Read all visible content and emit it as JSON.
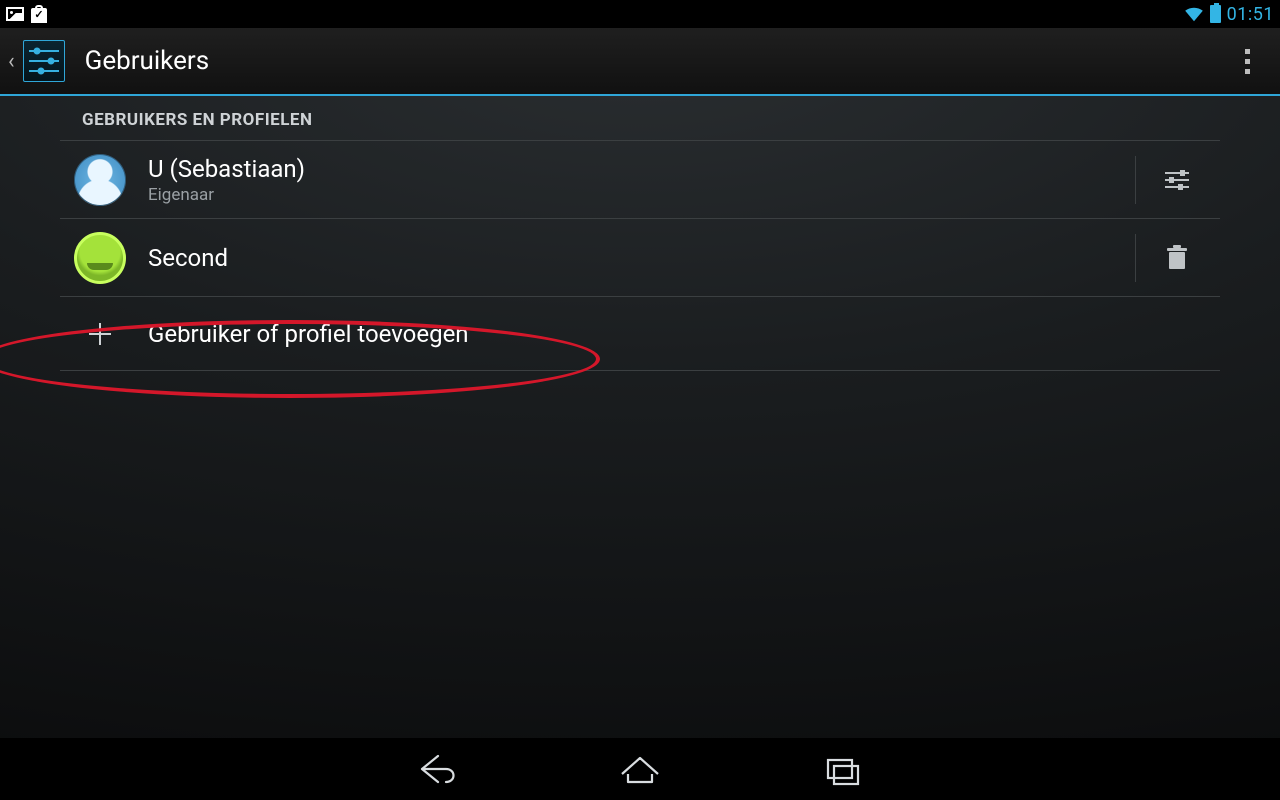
{
  "status": {
    "clock": "01:51"
  },
  "actionbar": {
    "title": "Gebruikers"
  },
  "section_header": "GEBRUIKERS EN PROFIELEN",
  "users": {
    "owner": {
      "name": "U (Sebastiaan)",
      "role": "Eigenaar"
    },
    "second": {
      "name": "Second"
    }
  },
  "add_label": "Gebruiker of profiel toevoegen",
  "colors": {
    "accent": "#33b5e5",
    "annotation": "#d4172a"
  }
}
